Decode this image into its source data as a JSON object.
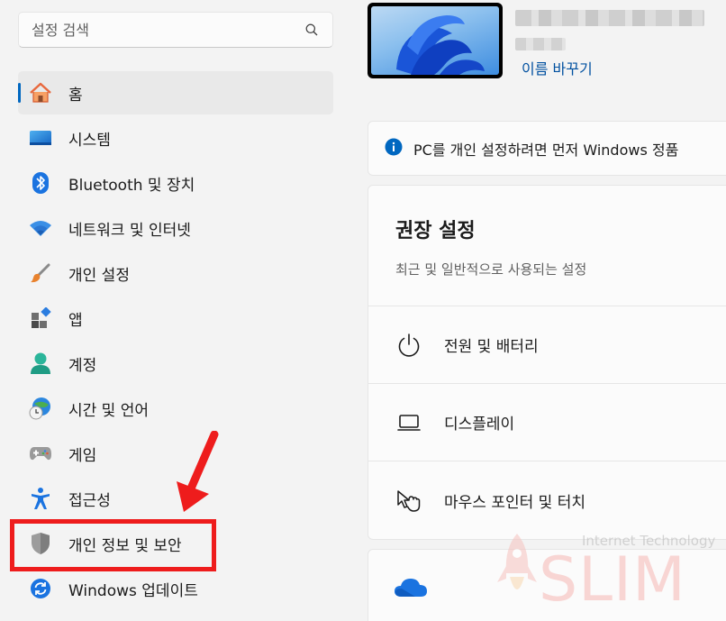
{
  "search": {
    "placeholder": "설정 검색",
    "icon": "search-icon"
  },
  "sidebar": {
    "items": [
      {
        "label": "홈",
        "icon": "home-icon",
        "active": true
      },
      {
        "label": "시스템",
        "icon": "system-icon"
      },
      {
        "label": "Bluetooth 및 장치",
        "icon": "bluetooth-icon"
      },
      {
        "label": "네트워크 및 인터넷",
        "icon": "wifi-icon"
      },
      {
        "label": "개인 설정",
        "icon": "brush-icon"
      },
      {
        "label": "앱",
        "icon": "apps-icon"
      },
      {
        "label": "계정",
        "icon": "account-icon"
      },
      {
        "label": "시간 및 언어",
        "icon": "time-language-icon"
      },
      {
        "label": "게임",
        "icon": "gamepad-icon"
      },
      {
        "label": "접근성",
        "icon": "accessibility-icon"
      },
      {
        "label": "개인 정보 및 보안",
        "icon": "shield-icon",
        "highlighted": true
      },
      {
        "label": "Windows 업데이트",
        "icon": "update-icon"
      }
    ]
  },
  "device": {
    "rename_label": "이름 바꾸기"
  },
  "info_banner": {
    "text": "PC를 개인 설정하려면 먼저 Windows 정품"
  },
  "recommended": {
    "title": "권장 설정",
    "subtitle": "최근 및 일반적으로 사용되는 설정",
    "items": [
      {
        "label": "전원 및 배터리",
        "icon": "power-icon"
      },
      {
        "label": "디스플레이",
        "icon": "display-icon"
      },
      {
        "label": "마우스 포인터 및 터치",
        "icon": "pointer-icon"
      }
    ]
  },
  "watermark": {
    "top": "Internet Technology",
    "brand": "SLIM"
  },
  "colors": {
    "accent": "#0067c0",
    "highlight": "#ee1c1c",
    "background": "#f3f3f3"
  }
}
